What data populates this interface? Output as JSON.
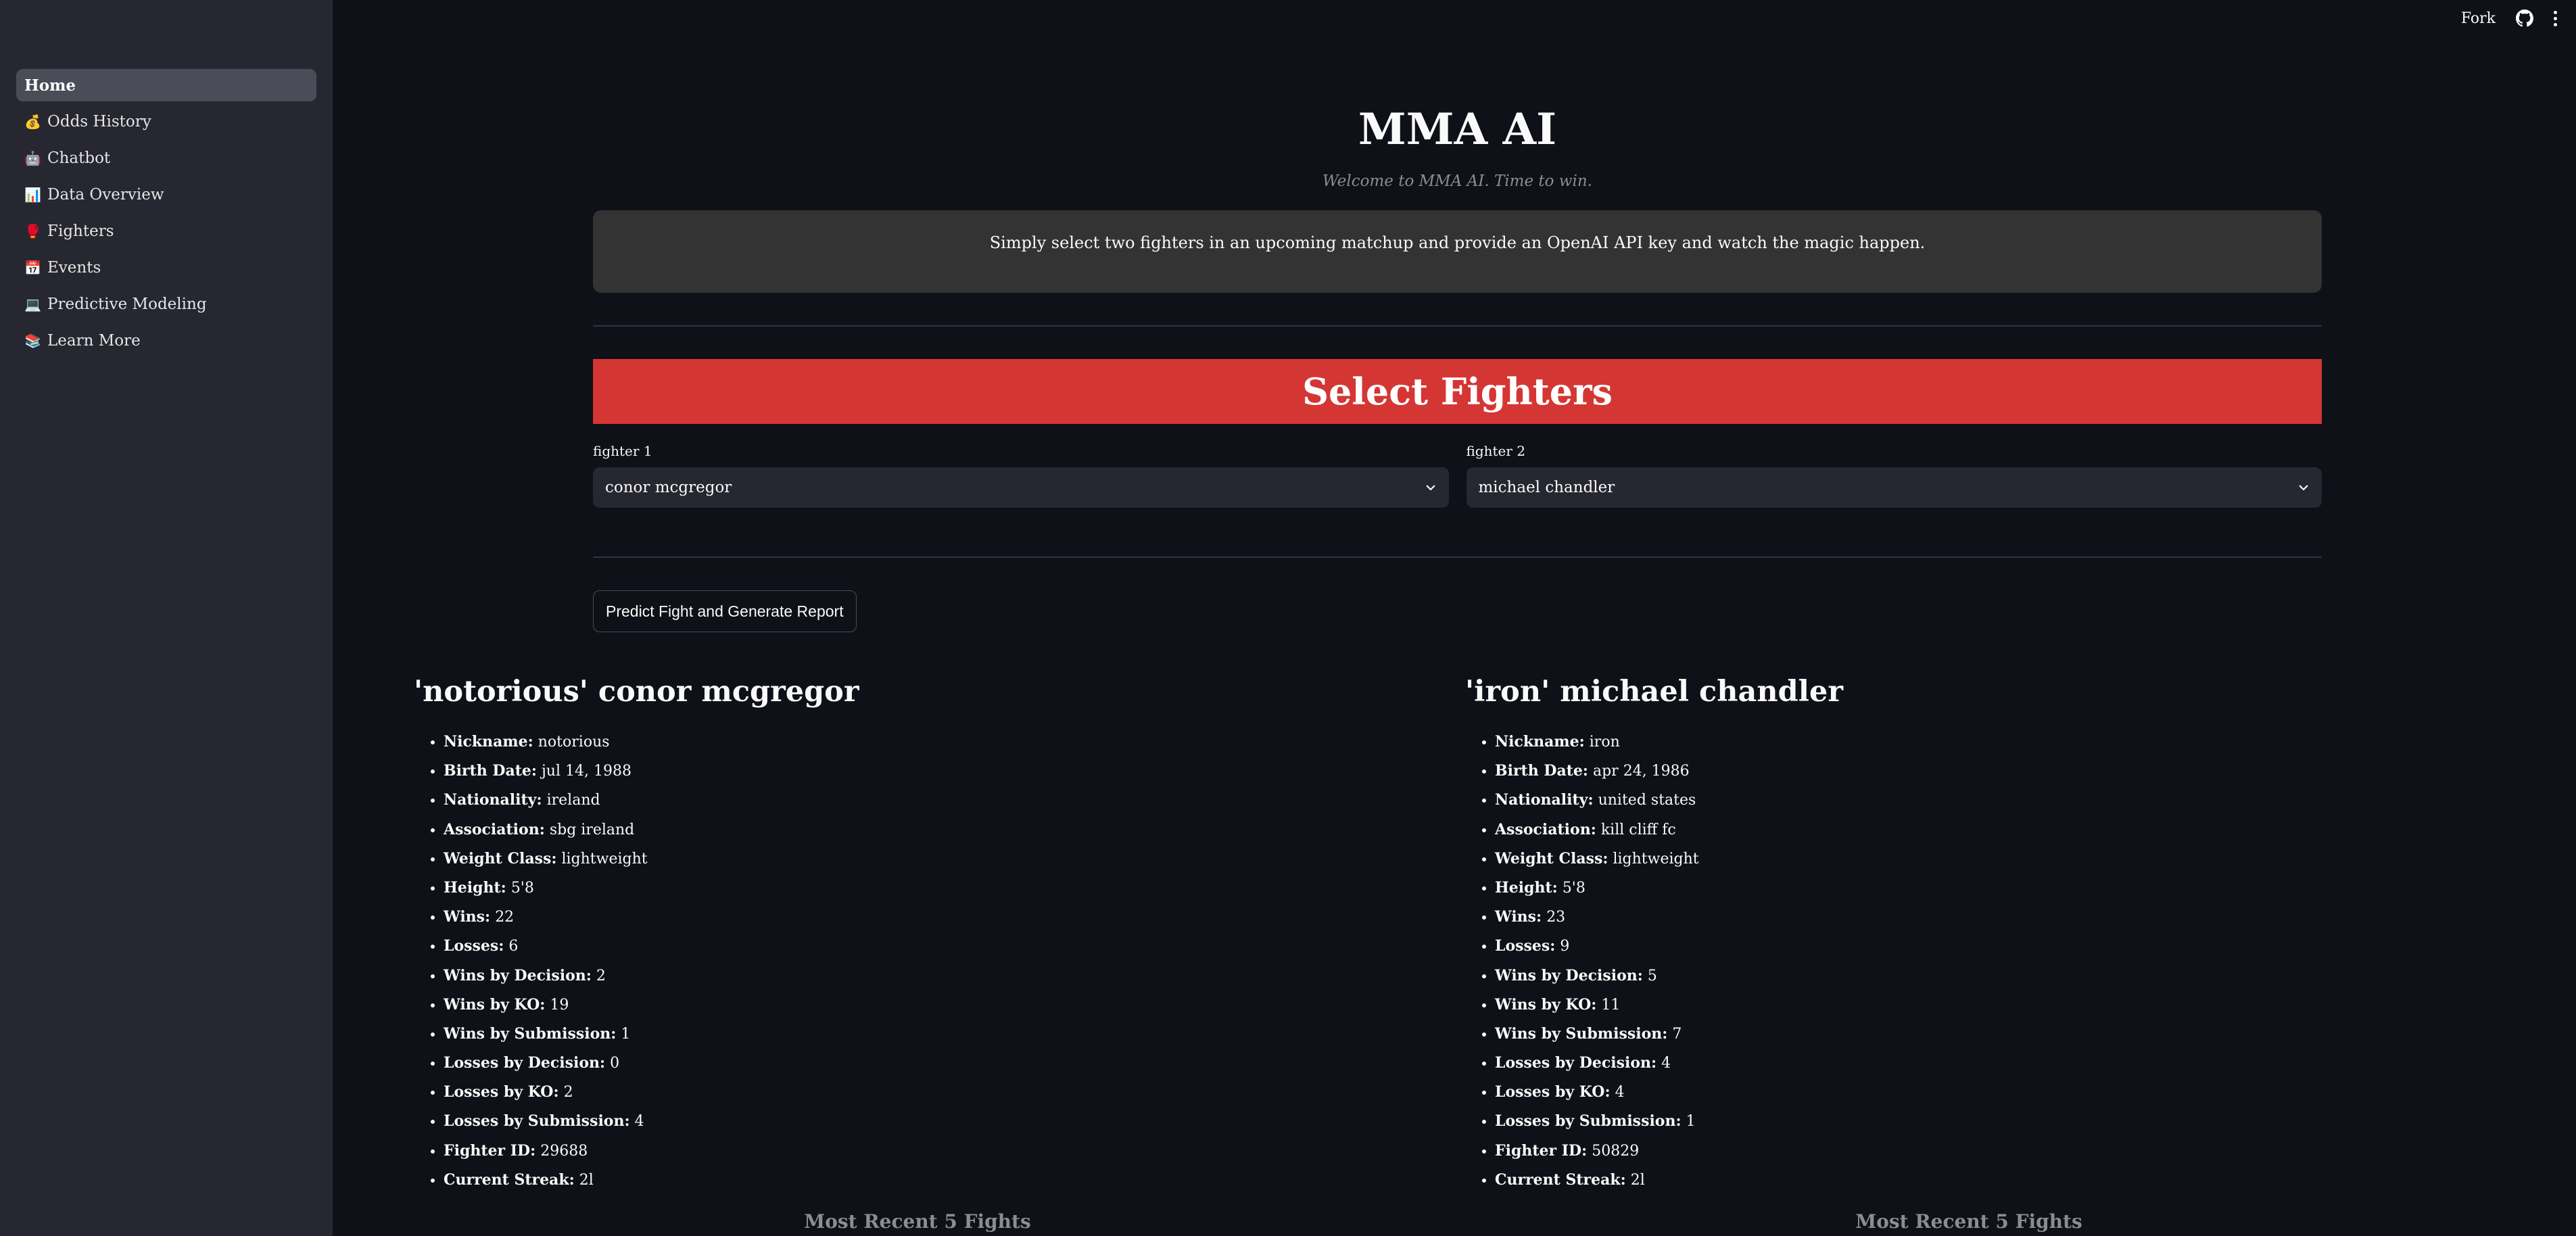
{
  "topbar": {
    "fork_label": "Fork"
  },
  "sidebar": {
    "items": [
      {
        "label": "Home",
        "icon": "",
        "active": true
      },
      {
        "label": "Odds History",
        "icon": "💰"
      },
      {
        "label": "Chatbot",
        "icon": "🤖"
      },
      {
        "label": "Data Overview",
        "icon": "📊"
      },
      {
        "label": "Fighters",
        "icon": "🥊"
      },
      {
        "label": "Events",
        "icon": "📅"
      },
      {
        "label": "Predictive Modeling",
        "icon": "💻"
      },
      {
        "label": "Learn More",
        "icon": "📚"
      }
    ]
  },
  "main": {
    "title": "MMA AI",
    "subtitle": "Welcome to MMA AI. Time to win.",
    "info": "Simply select two fighters in an upcoming matchup and provide an OpenAI API key and watch the magic happen.",
    "banner": "Select Fighters",
    "fighter1_label": "fighter 1",
    "fighter1_value": "conor mcgregor",
    "fighter2_label": "fighter 2",
    "fighter2_value": "michael chandler",
    "predict_button": "Predict Fight and Generate Report"
  },
  "fighter1": {
    "heading": "'notorious' conor mcgregor",
    "stats": [
      {
        "k": "Nickname:",
        "v": "notorious"
      },
      {
        "k": "Birth Date:",
        "v": "jul 14, 1988"
      },
      {
        "k": "Nationality:",
        "v": "ireland"
      },
      {
        "k": "Association:",
        "v": "sbg ireland"
      },
      {
        "k": "Weight Class:",
        "v": "lightweight"
      },
      {
        "k": "Height:",
        "v": "5'8"
      },
      {
        "k": "Wins:",
        "v": "22"
      },
      {
        "k": "Losses:",
        "v": "6"
      },
      {
        "k": "Wins by Decision:",
        "v": "2"
      },
      {
        "k": "Wins by KO:",
        "v": "19"
      },
      {
        "k": "Wins by Submission:",
        "v": "1"
      },
      {
        "k": "Losses by Decision:",
        "v": "0"
      },
      {
        "k": "Losses by KO:",
        "v": "2"
      },
      {
        "k": "Losses by Submission:",
        "v": "4"
      },
      {
        "k": "Fighter ID:",
        "v": "29688"
      },
      {
        "k": "Current Streak:",
        "v": "2l"
      }
    ],
    "recent_heading": "Most Recent 5 Fights"
  },
  "fighter2": {
    "heading": "'iron' michael chandler",
    "stats": [
      {
        "k": "Nickname:",
        "v": "iron"
      },
      {
        "k": "Birth Date:",
        "v": "apr 24, 1986"
      },
      {
        "k": "Nationality:",
        "v": "united states"
      },
      {
        "k": "Association:",
        "v": "kill cliff fc"
      },
      {
        "k": "Weight Class:",
        "v": "lightweight"
      },
      {
        "k": "Height:",
        "v": "5'8"
      },
      {
        "k": "Wins:",
        "v": "23"
      },
      {
        "k": "Losses:",
        "v": "9"
      },
      {
        "k": "Wins by Decision:",
        "v": "5"
      },
      {
        "k": "Wins by KO:",
        "v": "11"
      },
      {
        "k": "Wins by Submission:",
        "v": "7"
      },
      {
        "k": "Losses by Decision:",
        "v": "4"
      },
      {
        "k": "Losses by KO:",
        "v": "4"
      },
      {
        "k": "Losses by Submission:",
        "v": "1"
      },
      {
        "k": "Fighter ID:",
        "v": "50829"
      },
      {
        "k": "Current Streak:",
        "v": "2l"
      }
    ],
    "recent_heading": "Most Recent 5 Fights"
  }
}
